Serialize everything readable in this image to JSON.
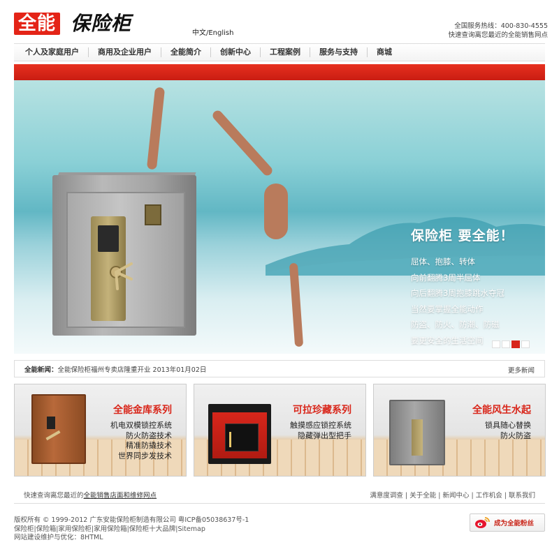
{
  "header": {
    "logo_mark": "全能",
    "logo_registered": "®",
    "logo_text": "保险柜",
    "lang": "中文/English",
    "hotline": "全国服务热线：400-830-4555",
    "hotline_sub": "快速查询离您最近的全能销售网点"
  },
  "nav": [
    "个人及家庭用户",
    "商用及企业用户",
    "全能简介",
    "创新中心",
    "工程案例",
    "服务与支持",
    "商城"
  ],
  "banner": {
    "title": "保险柜 要全能！",
    "lines": [
      "屈体、抱膝、转体",
      "向前翻腾3周半屈体",
      "向后翻腾3周抱膝跳水夺冠",
      "当然要掌握全能动作",
      "防盗、防火、防潮、防磁",
      "要更安全的生活空间"
    ],
    "slides": 4,
    "active_slide": 3
  },
  "news": {
    "label": "全能新闻：",
    "text": "全能保险柜福州专卖店隆重开业 2013年01月02日",
    "more": "更多新闻"
  },
  "products": [
    {
      "title": "全能金库系列",
      "lines": [
        "机电双模锁控系统",
        "防火防盗技术",
        "精准防撬技术",
        "世界同步发技术"
      ]
    },
    {
      "title": "可拉珍藏系列",
      "lines": [
        "触摸感应锁控系统",
        "隐藏弹出型把手"
      ]
    },
    {
      "title": "全能风生水起",
      "lines": [
        "锁具随心替换",
        "防火防盗"
      ]
    }
  ],
  "footer": {
    "left_prefix": "快速查询离您最近的",
    "left_link": "全能销售店面和维修网点",
    "links": [
      "满意度调查",
      "关于全能",
      "新闻中心",
      "工作机会",
      "联系我们"
    ],
    "copyright": [
      "版权所有 © 1999-2012 广东安能保险柜制造有限公司 粤ICP备05038637号-1",
      "保险柜|保险箱|家用保险柜|家用保险箱|保险柜十大品牌|Sitemap",
      "网站建设维护与优化：8HTML"
    ],
    "weibo": "成为全能粉丝"
  },
  "colors": {
    "accent": "#e42417"
  }
}
